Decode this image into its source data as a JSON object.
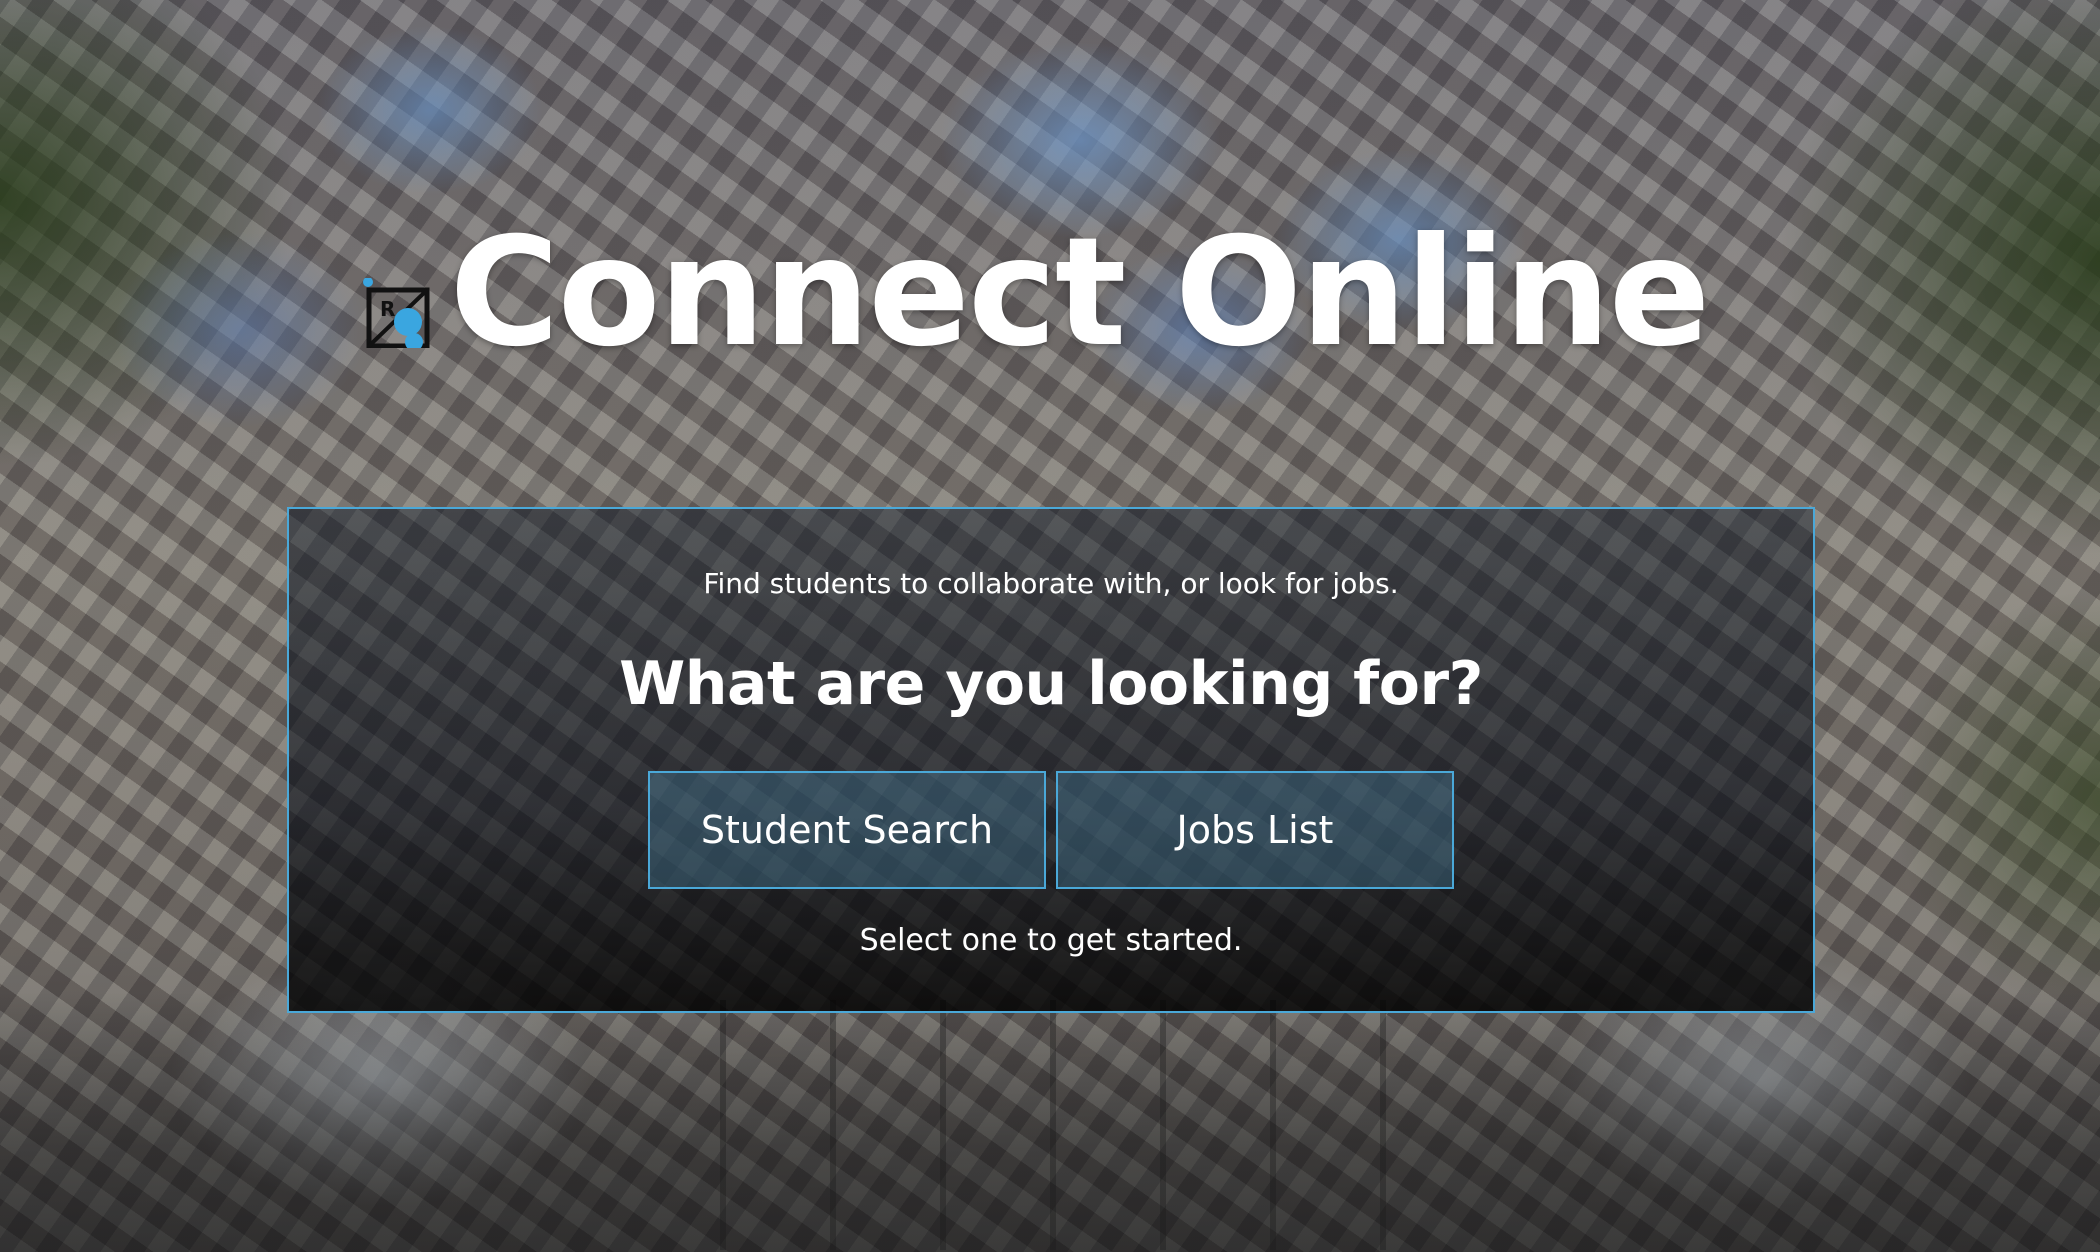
{
  "header": {
    "title": "Connect Online",
    "logo_icon": "logo-icon",
    "logo_letter": "R",
    "accent_color": "#4aa8d8"
  },
  "panel": {
    "subtitle": "Find students to collaborate with, or look for jobs.",
    "heading": "What are you looking for?",
    "buttons": [
      {
        "label": "Student Search"
      },
      {
        "label": "Jobs List"
      }
    ],
    "footer": "Select one to get started."
  }
}
